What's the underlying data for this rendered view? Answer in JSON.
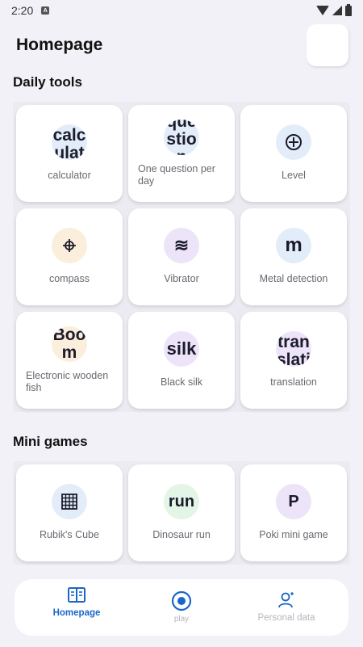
{
  "status": {
    "time": "2:20"
  },
  "header": {
    "title": "Homepage"
  },
  "daily_tools": {
    "title": "Daily tools",
    "items": [
      {
        "icon_text": "calculat",
        "label": "calculator",
        "icon": "text",
        "color": "#e3edf9"
      },
      {
        "icon_text": "question",
        "label": "One question per day",
        "icon": "text",
        "color": "#e3edf9"
      },
      {
        "icon_text": "⊕",
        "label": "Level",
        "icon": "level-icon",
        "color": "#e3edf9"
      },
      {
        "icon_text": "⌖",
        "label": "compass",
        "icon": "compass-icon",
        "color": "#fbeedd"
      },
      {
        "icon_text": "≋",
        "label": "Vibrator",
        "icon": "vibrate-icon",
        "color": "#eee4fa"
      },
      {
        "icon_text": "m",
        "label": "Metal detection",
        "icon": "text",
        "color": "#e3edf9"
      },
      {
        "icon_text": "Boom",
        "label": "Electronic wooden fish",
        "icon": "text",
        "color": "#fbeedd"
      },
      {
        "icon_text": "silk",
        "label": "Black silk",
        "icon": "text",
        "color": "#eee4fa"
      },
      {
        "icon_text": "translati",
        "label": "translation",
        "icon": "text",
        "color": "#eee4fa"
      }
    ]
  },
  "mini_games": {
    "title": "Mini games",
    "items": [
      {
        "icon_text": "▦",
        "label": "Rubik's Cube",
        "icon": "cube-grid-icon",
        "color": "#e3edf9"
      },
      {
        "icon_text": "run",
        "label": "Dinosaur run",
        "icon": "text",
        "color": "#e3f5e6"
      },
      {
        "icon_text": "P",
        "label": "Poki mini game",
        "icon": "text",
        "color": "#eee4fa"
      }
    ]
  },
  "nav": {
    "items": [
      {
        "label": "Homepage",
        "icon": "book-icon",
        "active": true
      },
      {
        "label": "play",
        "icon": "play-circle-icon",
        "active": false
      },
      {
        "label": "Personal data",
        "icon": "person-icon",
        "active": false
      }
    ],
    "accent": "#1a66c8"
  }
}
